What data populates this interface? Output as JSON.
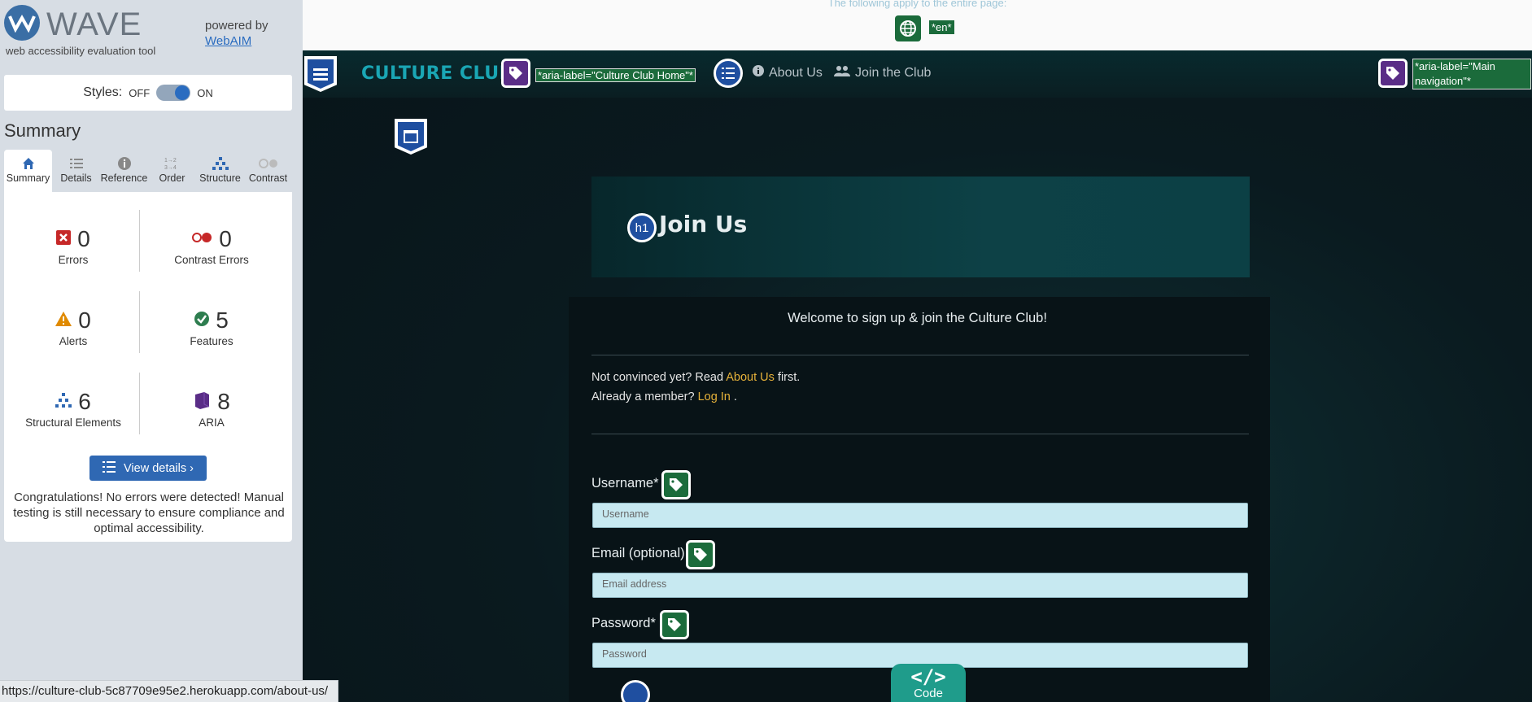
{
  "wave": {
    "logo_text": "WAVE",
    "subtitle": "web accessibility evaluation tool",
    "powered_by": "powered by",
    "webaim_link": "WebAIM",
    "styles_label": "Styles:",
    "styles_off": "OFF",
    "styles_on": "ON",
    "summary_title": "Summary",
    "tabs": [
      {
        "label": "Summary",
        "icon": "home-icon"
      },
      {
        "label": "Details",
        "icon": "list-icon"
      },
      {
        "label": "Reference",
        "icon": "info-icon"
      },
      {
        "label": "Order",
        "icon": "order-icon"
      },
      {
        "label": "Structure",
        "icon": "structure-icon"
      },
      {
        "label": "Contrast",
        "icon": "contrast-icon"
      }
    ],
    "stats": {
      "errors": {
        "value": "0",
        "label": "Errors"
      },
      "contrast_errors": {
        "value": "0",
        "label": "Contrast Errors"
      },
      "alerts": {
        "value": "0",
        "label": "Alerts"
      },
      "features": {
        "value": "5",
        "label": "Features"
      },
      "structural": {
        "value": "6",
        "label": "Structural Elements"
      },
      "aria": {
        "value": "8",
        "label": "ARIA"
      }
    },
    "view_details": "View details ›",
    "congrats": "Congratulations! No errors were detected! Manual testing is still necessary to ensure compliance and optimal accessibility.",
    "status_url": "https://culture-club-5c87709e95e2.herokuapp.com/about-us/"
  },
  "page": {
    "apply_note": "The following apply to the entire page:",
    "lang_label": "*en*",
    "brand": "CULTURE CLUB",
    "brand_aria": "*aria-label=\"Culture Club Home\"*",
    "nav_about": "About Us",
    "nav_join": "Join the Club",
    "nav_aria": "*aria-label=\"Main navigation\"*",
    "h1_badge": "h1",
    "heading": "Join Us",
    "welcome": "Welcome to sign up & join the Culture Club!",
    "not_convinced": "Not convinced yet? Read ",
    "about_link": "About Us",
    "first": " first.",
    "already": "Already a member? ",
    "login_link": "Log In",
    "dot": " .",
    "username_label": "Username*",
    "username_placeholder": "Username",
    "email_label": "Email (optional)",
    "email_placeholder": "Email address",
    "password_label": "Password*",
    "password_placeholder": "Password",
    "code_label": "Code",
    "code_symbol": "</>"
  },
  "colors": {
    "wave_blue": "#2f68b3",
    "wave_green": "#1b6b3b",
    "wave_purple": "#5a2d87",
    "brand_teal": "#1aa6b4",
    "link_gold": "#e6b23a",
    "input_bg": "#c7e9f1"
  }
}
